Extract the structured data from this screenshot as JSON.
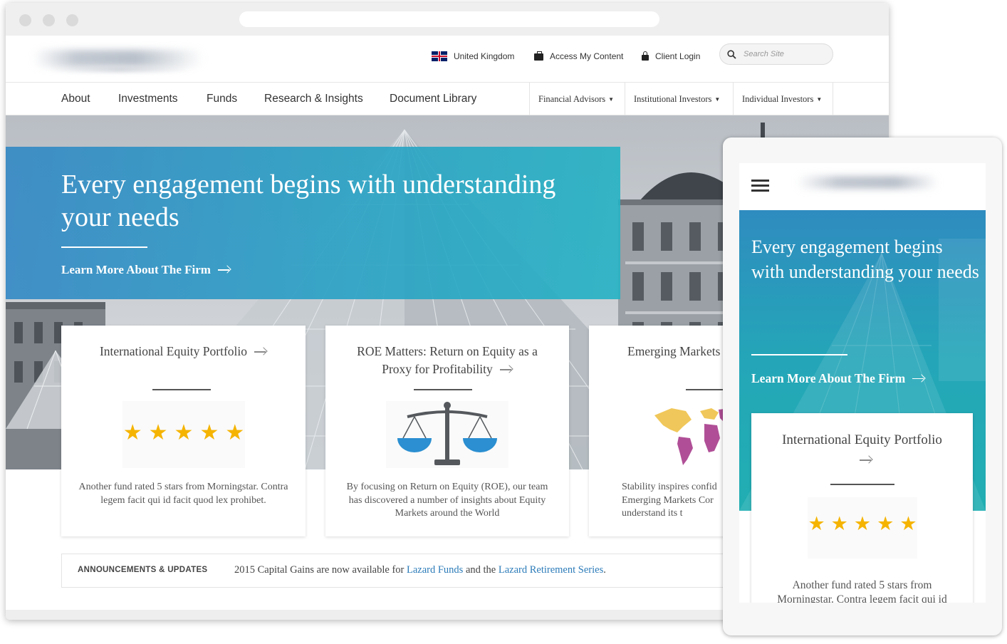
{
  "utility": {
    "country": "United Kingdom",
    "access": "Access My Content",
    "login": "Client Login",
    "search_placeholder": "Search Site"
  },
  "nav": {
    "items": [
      "About",
      "Investments",
      "Funds",
      "Research & Insights",
      "Document Library"
    ],
    "audiences": [
      "Financial Advisors",
      "Institutional Investors",
      "Individual Investors"
    ]
  },
  "hero": {
    "headline": "Every engagement begins with understanding your needs",
    "cta": "Learn More About The Firm"
  },
  "cards": [
    {
      "title": "International Equity Portfolio",
      "media": "five-star-rating",
      "rating": 5,
      "text": "Another fund rated 5 stars from Morningstar. Contra legem facit qui id facit quod lex prohibet."
    },
    {
      "title": "ROE Matters: Return on Equity as a Proxy for Profitability",
      "media": "scales-icon",
      "text": "By focusing on Return on Equity (ROE), our team has discovered a number of insights about Equity Markets around the World"
    },
    {
      "title": "Emerging Markets",
      "media": "world-map-icon",
      "text": "Stability inspires confid Emerging Markets Cor understand its t"
    }
  ],
  "announcements": {
    "label": "ANNOUNCEMENTS & UPDATES",
    "text_before": "2015 Capital Gains are now available for ",
    "link1": "Lazard Funds",
    "text_mid": " and the ",
    "link2": "Lazard Retirement Series",
    "text_after": "."
  },
  "mobile": {
    "headline": "Every engagement begins with understanding your needs",
    "cta": "Learn More About The Firm",
    "card": {
      "title": "International Equity Portfolio",
      "rating": 5,
      "text": "Another fund rated 5 stars from Morningstar. Contra legem facit qui id"
    }
  },
  "colors": {
    "hero_blue": "#2e86c4",
    "hero_teal": "#24b2c4",
    "star": "#f5b400",
    "scales_blue": "#2b8fd1",
    "map_yellow": "#f0c75a",
    "map_purple": "#b04f97",
    "link": "#2b7bb9"
  }
}
